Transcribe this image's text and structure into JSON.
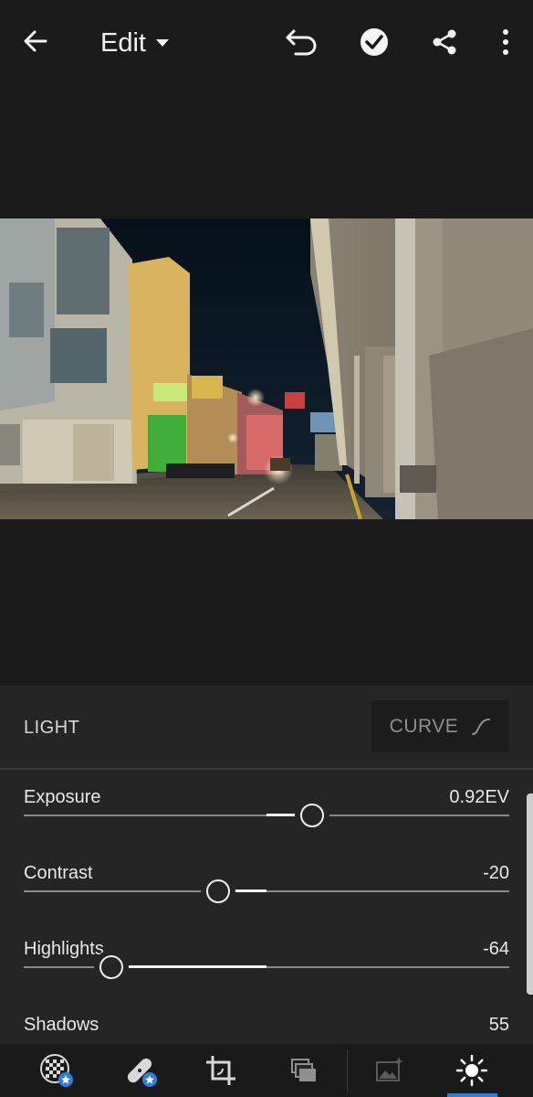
{
  "header": {
    "mode_label": "Edit",
    "icons": [
      "back-arrow-icon",
      "dropdown-caret-icon",
      "undo-icon",
      "done-check-icon",
      "share-icon",
      "more-vertical-icon"
    ]
  },
  "panel": {
    "section_title": "LIGHT",
    "curve_label": "CURVE",
    "sliders": [
      {
        "name": "Exposure",
        "value": "0.92EV",
        "position": 0.59
      },
      {
        "name": "Contrast",
        "value": "-20",
        "position": 0.4
      },
      {
        "name": "Highlights",
        "value": "-64",
        "position": 0.18
      },
      {
        "name": "Shadows",
        "value": "55"
      }
    ]
  },
  "toolbar": {
    "tools": [
      "selective-icon",
      "healing-icon",
      "crop-icon",
      "profiles-icon",
      "presets-icon",
      "light-icon"
    ],
    "active_tool": "light-icon"
  },
  "colors": {
    "background": "#1c1c1c",
    "panel": "#252525",
    "accent": "#2d7fdb"
  }
}
